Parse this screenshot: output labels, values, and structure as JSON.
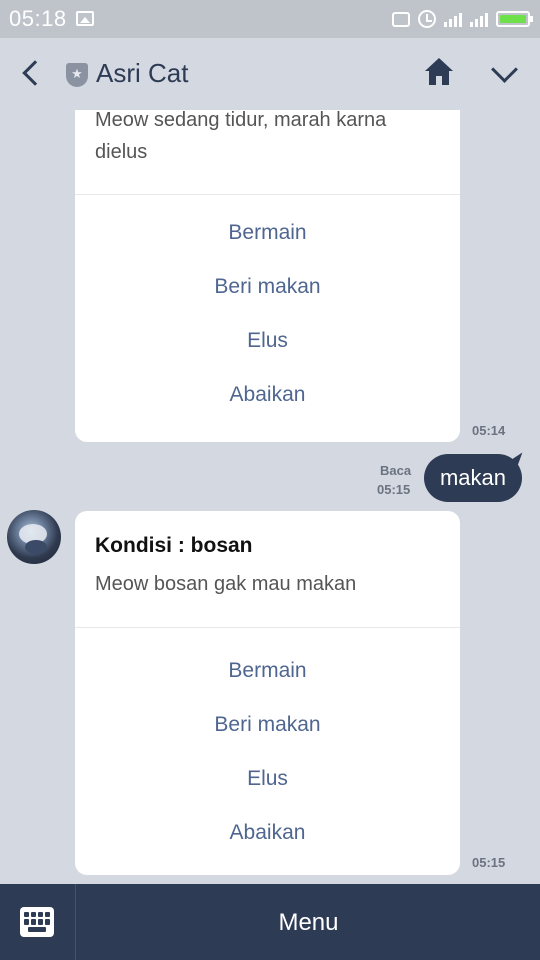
{
  "status_bar": {
    "time": "05:18",
    "icons": [
      "photo-icon",
      "message-icon",
      "alarm-icon",
      "signal-icon",
      "signal-icon",
      "battery-charging-icon"
    ],
    "battery_color": "#6ee04a"
  },
  "header": {
    "title": "Asri Cat",
    "icons": [
      "back-icon",
      "shield-icon",
      "home-icon",
      "chevron-down-icon"
    ]
  },
  "messages": {
    "card1": {
      "description": "Meow sedang tidur, marah karna dielus",
      "actions": [
        "Bermain",
        "Beri makan",
        "Elus",
        "Abaikan"
      ],
      "time": "05:14"
    },
    "sent": {
      "text": "makan",
      "read_label": "Baca",
      "time": "05:15"
    },
    "card2": {
      "title": "Kondisi : bosan",
      "description": "Meow bosan gak mau makan",
      "actions": [
        "Bermain",
        "Beri makan",
        "Elus",
        "Abaikan"
      ],
      "time": "05:15"
    }
  },
  "bottom_bar": {
    "keyboard_icon": "keyboard-icon",
    "menu_label": "Menu"
  },
  "colors": {
    "background": "#d3d8e1",
    "accent": "#2e3b55",
    "action_text": "#4f6690"
  }
}
